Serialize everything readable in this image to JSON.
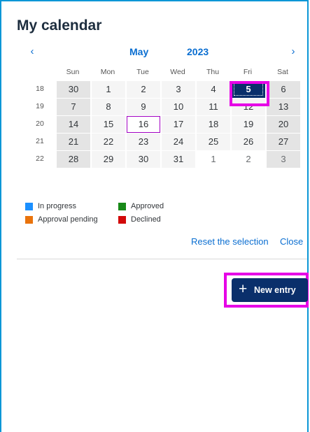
{
  "title": "My calendar",
  "nav": {
    "prev_icon": "chevron-left-icon",
    "next_icon": "chevron-right-icon",
    "prev_glyph": "‹",
    "next_glyph": "›",
    "month": "May",
    "year": "2023"
  },
  "weekdays": [
    "Sun",
    "Mon",
    "Tue",
    "Wed",
    "Thu",
    "Fri",
    "Sat"
  ],
  "weeks": [
    {
      "number": "18",
      "days": [
        {
          "label": "30",
          "other": false,
          "weekend": true
        },
        {
          "label": "1",
          "other": false,
          "weekend": false
        },
        {
          "label": "2",
          "other": false,
          "weekend": false
        },
        {
          "label": "3",
          "other": false,
          "weekend": false
        },
        {
          "label": "4",
          "other": false,
          "weekend": false
        },
        {
          "label": "5",
          "other": false,
          "weekend": false,
          "selected": true
        },
        {
          "label": "6",
          "other": false,
          "weekend": true
        }
      ]
    },
    {
      "number": "19",
      "days": [
        {
          "label": "7",
          "weekend": true
        },
        {
          "label": "8"
        },
        {
          "label": "9"
        },
        {
          "label": "10"
        },
        {
          "label": "11"
        },
        {
          "label": "12"
        },
        {
          "label": "13",
          "weekend": true
        }
      ]
    },
    {
      "number": "20",
      "days": [
        {
          "label": "14",
          "weekend": true
        },
        {
          "label": "15"
        },
        {
          "label": "16",
          "today": true
        },
        {
          "label": "17"
        },
        {
          "label": "18"
        },
        {
          "label": "19"
        },
        {
          "label": "20",
          "weekend": true
        }
      ]
    },
    {
      "number": "21",
      "days": [
        {
          "label": "21",
          "weekend": true
        },
        {
          "label": "22"
        },
        {
          "label": "23"
        },
        {
          "label": "24"
        },
        {
          "label": "25"
        },
        {
          "label": "26"
        },
        {
          "label": "27",
          "weekend": true
        }
      ]
    },
    {
      "number": "22",
      "days": [
        {
          "label": "28",
          "weekend": true
        },
        {
          "label": "29"
        },
        {
          "label": "30"
        },
        {
          "label": "31"
        },
        {
          "label": "1",
          "other": true
        },
        {
          "label": "2",
          "other": true
        },
        {
          "label": "3",
          "other": true,
          "weekend": true
        }
      ]
    }
  ],
  "legend": [
    {
      "label": "In progress",
      "color": "#1b90ff"
    },
    {
      "label": "Approved",
      "color": "#188918"
    },
    {
      "label": "Approval pending",
      "color": "#e9730c"
    },
    {
      "label": "Declined",
      "color": "#d20a0a"
    }
  ],
  "actions": {
    "reset": "Reset the selection",
    "close": "Close"
  },
  "new_entry": {
    "label": "New entry",
    "icon": "plus-icon",
    "glyph": "+"
  },
  "colors": {
    "accent": "#0a6ed1",
    "button_bg": "#0a2f6b",
    "highlight": "#e600e6",
    "today_border": "#a100c2"
  }
}
